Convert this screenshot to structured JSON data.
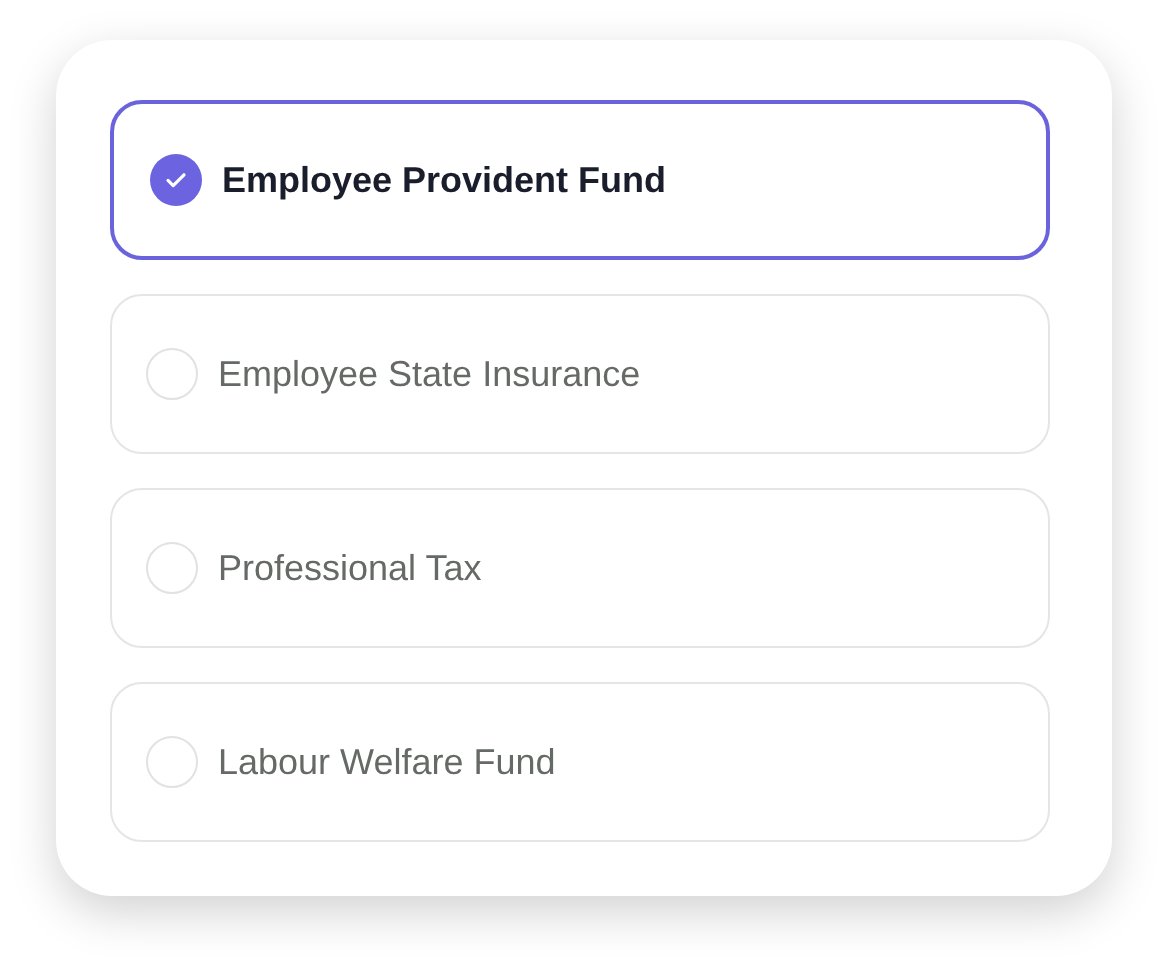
{
  "options": [
    {
      "label": "Employee Provident Fund",
      "selected": true
    },
    {
      "label": "Employee State Insurance",
      "selected": false
    },
    {
      "label": "Professional Tax",
      "selected": false
    },
    {
      "label": "Labour Welfare Fund",
      "selected": false
    }
  ]
}
